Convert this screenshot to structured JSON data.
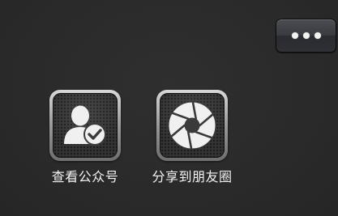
{
  "toolbar": {
    "more_icon": "more-dots-icon"
  },
  "share_items": [
    {
      "label": "查看公众号",
      "icon": "user-check-icon"
    },
    {
      "label": "分享到朋友圈",
      "icon": "camera-aperture-icon"
    }
  ]
}
